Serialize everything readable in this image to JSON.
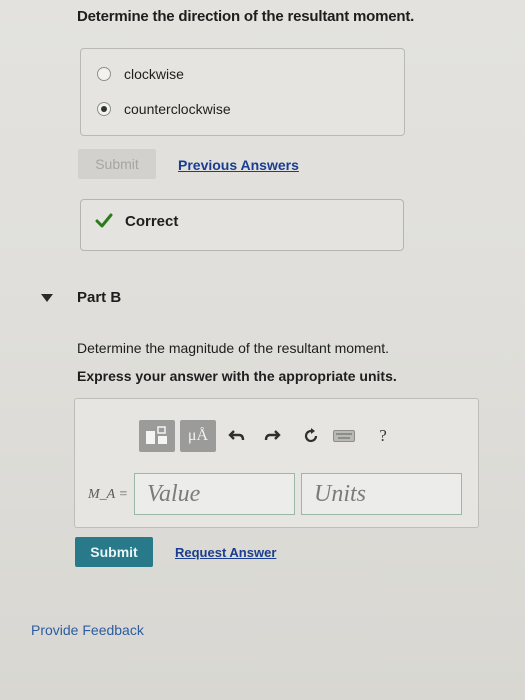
{
  "part_a": {
    "question": "Determine the direction of the resultant moment.",
    "options": [
      {
        "label": "clockwise",
        "selected": false
      },
      {
        "label": "counterclockwise",
        "selected": true
      }
    ],
    "submit_label": "Submit",
    "previous_answers_label": "Previous Answers",
    "result_label": "Correct",
    "result_color": "#2d7a1d"
  },
  "part_b": {
    "title": "Part B",
    "question": "Determine the magnitude of the resultant moment.",
    "instruction": "Express your answer with the appropriate units.",
    "toolbar": {
      "units_button_label": "μÅ",
      "help_label": "?"
    },
    "variable_label": "M_A =",
    "value_placeholder": "Value",
    "units_placeholder": "Units",
    "submit_label": "Submit",
    "request_answer_label": "Request Answer"
  },
  "feedback_label": "Provide Feedback",
  "colors": {
    "accent_button": "#287a8a",
    "link": "#1a3d8f",
    "check": "#2d7a1d"
  }
}
